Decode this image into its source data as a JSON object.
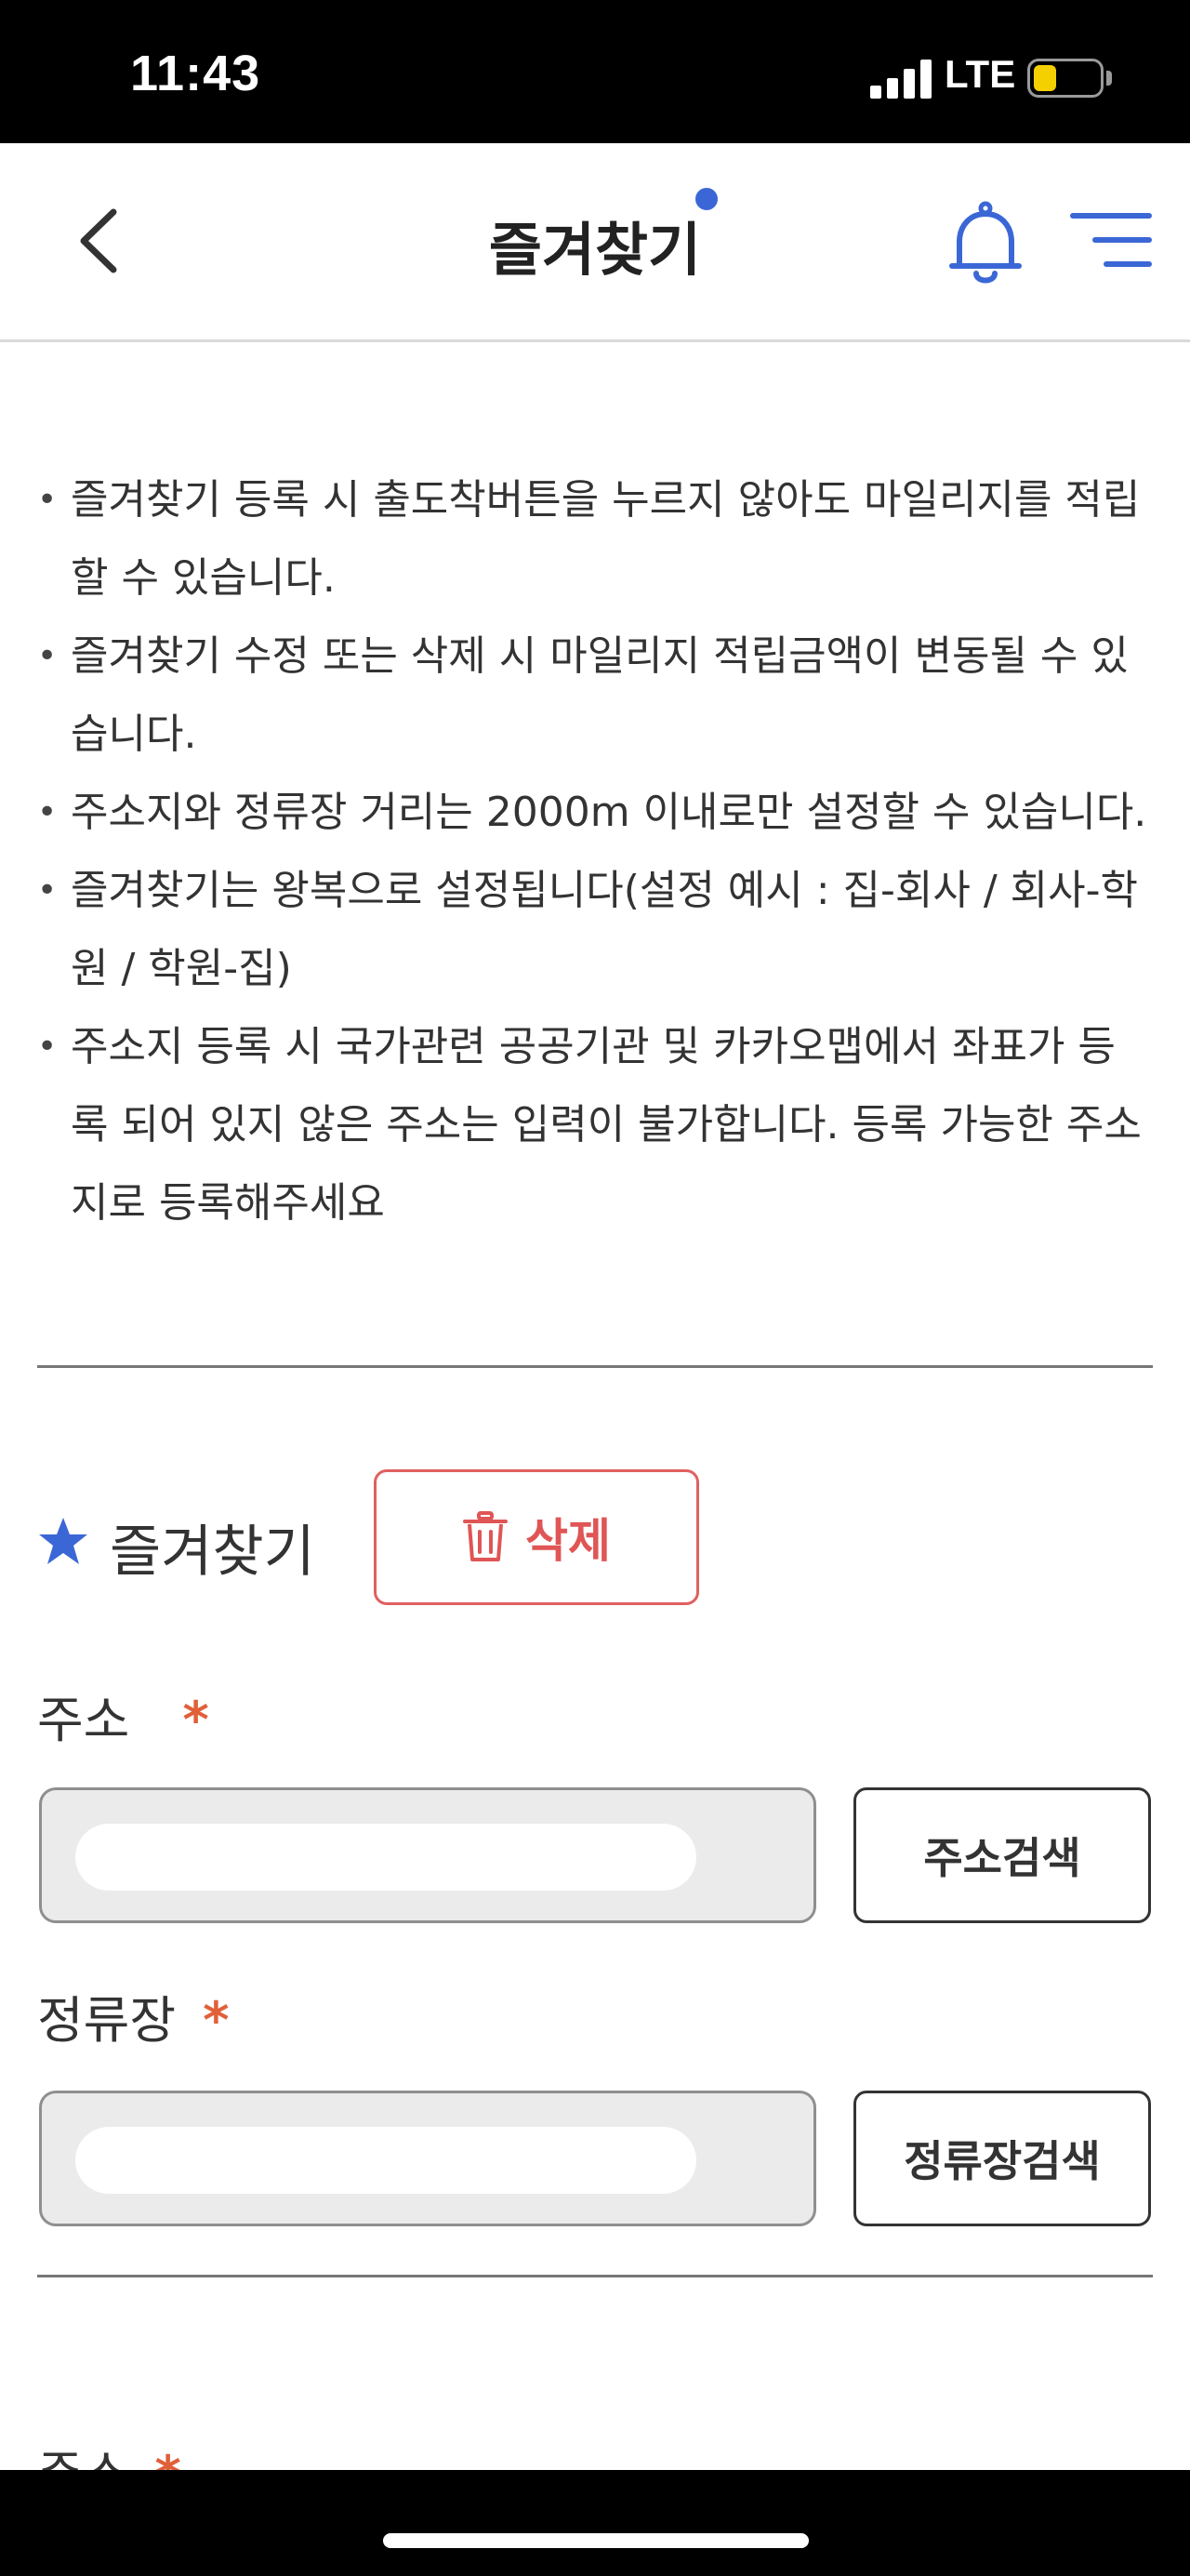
{
  "status_bar": {
    "time": "11:43",
    "network": "LTE"
  },
  "header": {
    "title": "즐겨찾기"
  },
  "notices": [
    "즐겨찾기 등록 시 출도착버튼을 누르지 않아도 마일리지를 적립할 수 있습니다.",
    "즐겨찾기 수정 또는 삭제 시 마일리지 적립금액이 변동될 수 있습니다.",
    "주소지와 정류장 거리는 2000m 이내로만 설정할 수 있습니다.",
    "즐겨찾기는 왕복으로 설정됩니다(설정 예시 : 집-회사 / 회사-학원 / 학원-집)",
    "주소지 등록 시 국가관련 공공기관 및 카카오맵에서 좌표가 등록 되어 있지 않은 주소는 입력이 불가합니다. 등록 가능한 주소지로 등록해주세요"
  ],
  "favorite": {
    "label": "즐겨찾기",
    "delete_label": "삭제",
    "address_label": "주소",
    "address_value": "",
    "address_search_label": "주소검색",
    "stop_label": "정류장",
    "stop_value": "",
    "stop_search_label": "정류장검색",
    "required_mark": "*"
  },
  "next_section": {
    "address_label": "주소"
  },
  "colors": {
    "accent": "#3b67d6",
    "danger": "#e05555",
    "required": "#e0603a"
  }
}
